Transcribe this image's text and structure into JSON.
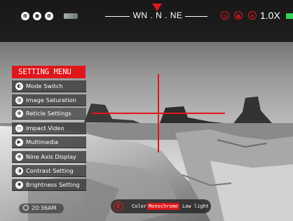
{
  "topbar": {
    "compass_text": "WN . N . NE",
    "zoom_text": "1.0X",
    "icons": [
      "wifi-icon",
      "camera-icon",
      "record-icon",
      "battery-icon",
      "photo-red-icon",
      "video-red-icon",
      "settings-red-icon",
      "battery-level-icon"
    ]
  },
  "menu": {
    "title": "SETTING MENU",
    "items": [
      {
        "label": "Mode Switch",
        "icon": "mode-switch-icon",
        "glyph": "◐"
      },
      {
        "label": "Image Saturation",
        "icon": "image-saturation-icon",
        "glyph": "◍"
      },
      {
        "label": "Reticle Settings",
        "icon": "reticle-icon",
        "glyph": "⊕"
      },
      {
        "label": "Impact Video",
        "icon": "impact-video-icon",
        "glyph": "▭"
      },
      {
        "label": "Multimedia",
        "icon": "multimedia-icon",
        "glyph": "▶"
      },
      {
        "label": "Nine Axis Display",
        "icon": "nine-axis-icon",
        "glyph": "⊗"
      },
      {
        "label": "Contrast Setting",
        "icon": "contrast-icon",
        "glyph": "◑"
      },
      {
        "label": "Brightness Setting",
        "icon": "brightness-icon",
        "glyph": "✺"
      }
    ],
    "selected_index": 2
  },
  "status": {
    "time": "20:36AM"
  },
  "color_mode": {
    "label": "Color",
    "selected": "Monochrome",
    "other": "Low light"
  },
  "colors": {
    "accent_red": "#e0161b",
    "battery_green": "#35d35b"
  }
}
